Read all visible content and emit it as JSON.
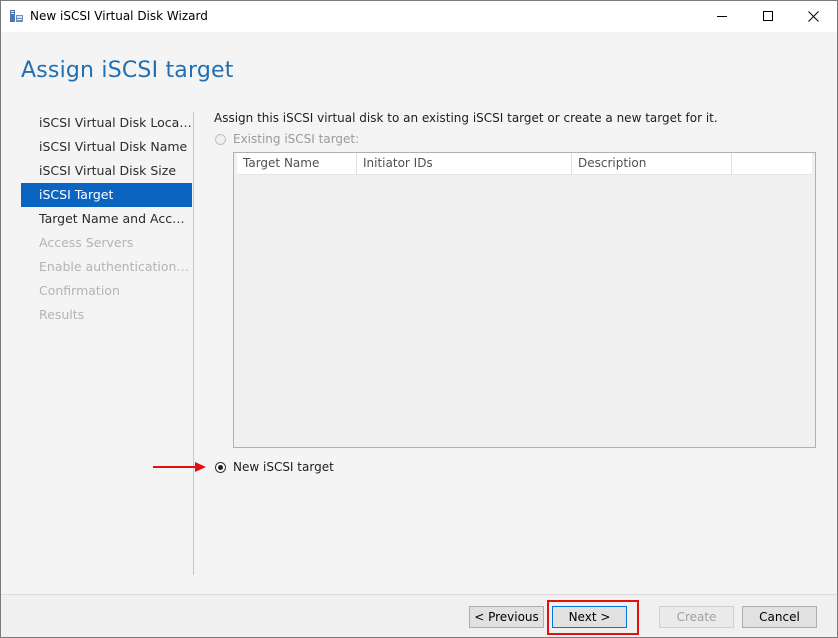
{
  "window": {
    "title": "New iSCSI Virtual Disk Wizard"
  },
  "page": {
    "title": "Assign iSCSI target"
  },
  "nav": {
    "items": [
      {
        "label": "iSCSI Virtual Disk Location",
        "state": "normal"
      },
      {
        "label": "iSCSI Virtual Disk Name",
        "state": "normal"
      },
      {
        "label": "iSCSI Virtual Disk Size",
        "state": "normal"
      },
      {
        "label": "iSCSI Target",
        "state": "active"
      },
      {
        "label": "Target Name and Access",
        "state": "normal"
      },
      {
        "label": "Access Servers",
        "state": "disabled"
      },
      {
        "label": "Enable authentication ser...",
        "state": "disabled"
      },
      {
        "label": "Confirmation",
        "state": "disabled"
      },
      {
        "label": "Results",
        "state": "disabled"
      }
    ]
  },
  "main": {
    "instruction": "Assign this iSCSI virtual disk to an existing iSCSI target or create a new target for it.",
    "existing_option": {
      "label": "Existing iSCSI target:",
      "selected": false,
      "enabled": false
    },
    "targets_table": {
      "columns": [
        "Target Name",
        "Initiator IDs",
        "Description"
      ],
      "rows": []
    },
    "new_option": {
      "label": "New iSCSI target",
      "selected": true,
      "enabled": true
    }
  },
  "footer": {
    "previous_label": "< Previous",
    "next_label": "Next >",
    "create_label": "Create",
    "cancel_label": "Cancel"
  },
  "colors": {
    "accent": "#0a65c2",
    "title": "#1f6fb4",
    "annotation": "#e01010"
  }
}
